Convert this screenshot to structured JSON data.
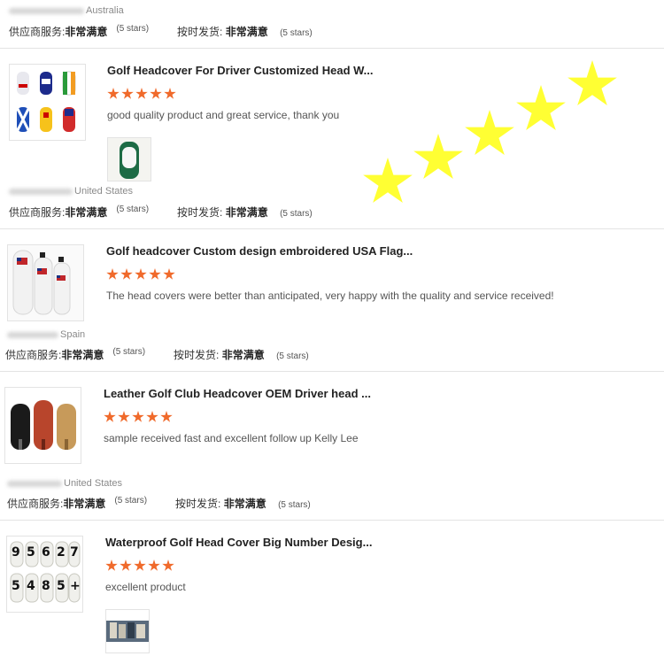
{
  "labels": {
    "supplier_service": "供应商服务:",
    "on_time_delivery": "按时发货:",
    "rating_value": "非常满意",
    "rating_stars": "(5 stars)"
  },
  "colors": {
    "star_orange": "#f06a2b",
    "overlay_star_yellow": "#ffff33"
  },
  "overlay_stars": {
    "count": 5
  },
  "reviews": [
    {
      "country": "Australia"
    },
    {
      "title": "Golf Headcover For Driver Customized Head W...",
      "stars": 5,
      "comment": "good quality product and great service, thank you",
      "country": "United States",
      "has_attachment": true
    },
    {
      "title": "Golf headcover Custom design embroidered USA Flag...",
      "stars": 5,
      "comment": "The head covers were better than anticipated, very happy with the quality and service received!",
      "country": "Spain",
      "has_attachment": false
    },
    {
      "title": "Leather Golf Club Headcover OEM Driver head ...",
      "stars": 5,
      "comment": "sample received fast and excellent follow up Kelly Lee",
      "country": "United States",
      "has_attachment": false
    },
    {
      "title": "Waterproof Golf Head Cover Big Number Desig...",
      "stars": 5,
      "comment": "excellent product",
      "has_attachment": true
    }
  ]
}
